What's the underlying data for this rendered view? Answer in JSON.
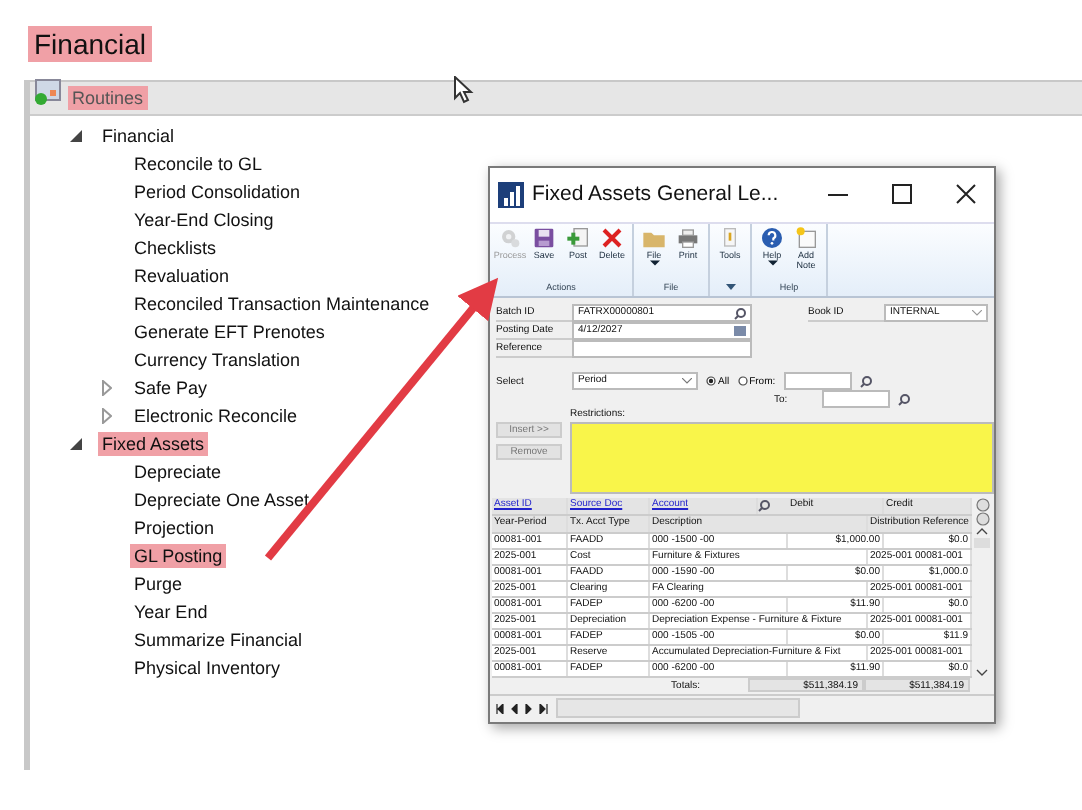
{
  "page": {
    "title": "Financial",
    "title_highlighted": true
  },
  "panel": {
    "title": "Routines",
    "title_highlighted": true
  },
  "tree": [
    {
      "label": "Financial",
      "expanded": true,
      "highlighted": false,
      "children": [
        {
          "label": "Reconcile to GL",
          "highlighted": false
        },
        {
          "label": "Period Consolidation",
          "highlighted": false
        },
        {
          "label": "Year-End Closing",
          "highlighted": false
        },
        {
          "label": "Checklists",
          "highlighted": false
        },
        {
          "label": "Revaluation",
          "highlighted": false
        },
        {
          "label": "Reconciled Transaction Maintenance",
          "highlighted": false
        },
        {
          "label": "Generate EFT Prenotes",
          "highlighted": false
        },
        {
          "label": "Currency Translation",
          "highlighted": false
        },
        {
          "label": "Safe Pay",
          "expanded": false,
          "highlighted": false
        },
        {
          "label": "Electronic Reconcile",
          "expanded": false,
          "highlighted": false
        }
      ]
    },
    {
      "label": "Fixed Assets",
      "expanded": true,
      "highlighted": true,
      "children": [
        {
          "label": "Depreciate",
          "highlighted": false
        },
        {
          "label": "Depreciate One Asset",
          "highlighted": false
        },
        {
          "label": "Projection",
          "highlighted": false
        },
        {
          "label": "GL Posting",
          "highlighted": true
        },
        {
          "label": "Purge",
          "highlighted": false
        },
        {
          "label": "Year End",
          "highlighted": false
        },
        {
          "label": "Summarize Financial",
          "highlighted": false
        },
        {
          "label": "Physical Inventory",
          "highlighted": false
        }
      ]
    }
  ],
  "window": {
    "title": "Fixed Assets General Le...",
    "ribbon": [
      {
        "label": "Actions",
        "buttons": [
          {
            "label": "Process",
            "kind": "gear",
            "disabled": true,
            "menu": false
          },
          {
            "label": "Save",
            "kind": "disk",
            "disabled": false,
            "menu": false
          },
          {
            "label": "Post",
            "kind": "post",
            "disabled": false,
            "menu": false
          },
          {
            "label": "Delete",
            "kind": "delete",
            "disabled": false,
            "menu": false
          }
        ]
      },
      {
        "label": "File",
        "buttons": [
          {
            "label": "File",
            "kind": "folder",
            "disabled": false,
            "menu": true
          },
          {
            "label": "Print",
            "kind": "printer",
            "disabled": false,
            "menu": false
          }
        ]
      },
      {
        "buttons": [
          {
            "label": "Tools",
            "kind": "tools",
            "disabled": false,
            "menu": false
          }
        ],
        "menu": true
      },
      {
        "label": "Help",
        "buttons": [
          {
            "label": "Help",
            "kind": "help",
            "disabled": false,
            "menu": true
          },
          {
            "label": "Add Note",
            "kind": "note",
            "disabled": false,
            "menu": false
          }
        ]
      }
    ],
    "batch_id": {
      "label": "Batch ID",
      "value": "FATRX00000801"
    },
    "posting_date": {
      "label": "Posting Date",
      "value": "4/12/2027"
    },
    "reference": {
      "label": "Reference"
    },
    "book_id": {
      "label": "Book ID",
      "value": "INTERNAL"
    },
    "select": {
      "label": "Select",
      "value": "Period"
    },
    "range": [
      {
        "label": "All",
        "selected": true
      },
      {
        "label": "From:",
        "selected": false
      }
    ],
    "to_label": "To:",
    "restrictions_label": "Restrictions:",
    "side_buttons": [
      {
        "label": "Insert >>",
        "disabled": true
      },
      {
        "label": "Remove",
        "disabled": true
      }
    ],
    "grid": {
      "link_headers": [
        "Asset ID",
        "Source Doc",
        "Account"
      ],
      "amount_headers": [
        "Debit",
        "Credit"
      ],
      "headers": [
        "Year-Period",
        "Tx. Acct Type",
        "Description",
        "Distribution Reference"
      ],
      "rows": [
        {
          "kind": "account",
          "cells": [
            "00081-001",
            "FAADD",
            "000 -1500 -00",
            "$1,000.00",
            "$0.0"
          ]
        },
        {
          "kind": "detail",
          "cells": [
            "2025-001",
            "Cost",
            "Furniture & Fixtures",
            "2025-001 00081-001"
          ]
        },
        {
          "kind": "account",
          "cells": [
            "00081-001",
            "FAADD",
            "000 -1590 -00",
            "$0.00",
            "$1,000.0"
          ]
        },
        {
          "kind": "detail",
          "cells": [
            "2025-001",
            "Clearing",
            "FA Clearing",
            "2025-001 00081-001"
          ]
        },
        {
          "kind": "account",
          "cells": [
            "00081-001",
            "FADEP",
            "000 -6200 -00",
            "$11.90",
            "$0.0"
          ]
        },
        {
          "kind": "detail",
          "cells": [
            "2025-001",
            "Depreciation",
            "Depreciation Expense - Furniture & Fixture",
            "2025-001 00081-001"
          ]
        },
        {
          "kind": "account",
          "cells": [
            "00081-001",
            "FADEP",
            "000 -1505 -00",
            "$0.00",
            "$11.9"
          ]
        },
        {
          "kind": "detail",
          "cells": [
            "2025-001",
            "Reserve",
            "Accumulated Depreciation-Furniture & Fixt",
            "2025-001 00081-001"
          ]
        },
        {
          "kind": "account",
          "cells": [
            "00081-001",
            "FADEP",
            "000 -6200 -00",
            "$11.90",
            "$0.0"
          ]
        }
      ],
      "totals_label": "Totals:",
      "totals": [
        "$511,384.19",
        "$511,384.19"
      ]
    }
  }
}
